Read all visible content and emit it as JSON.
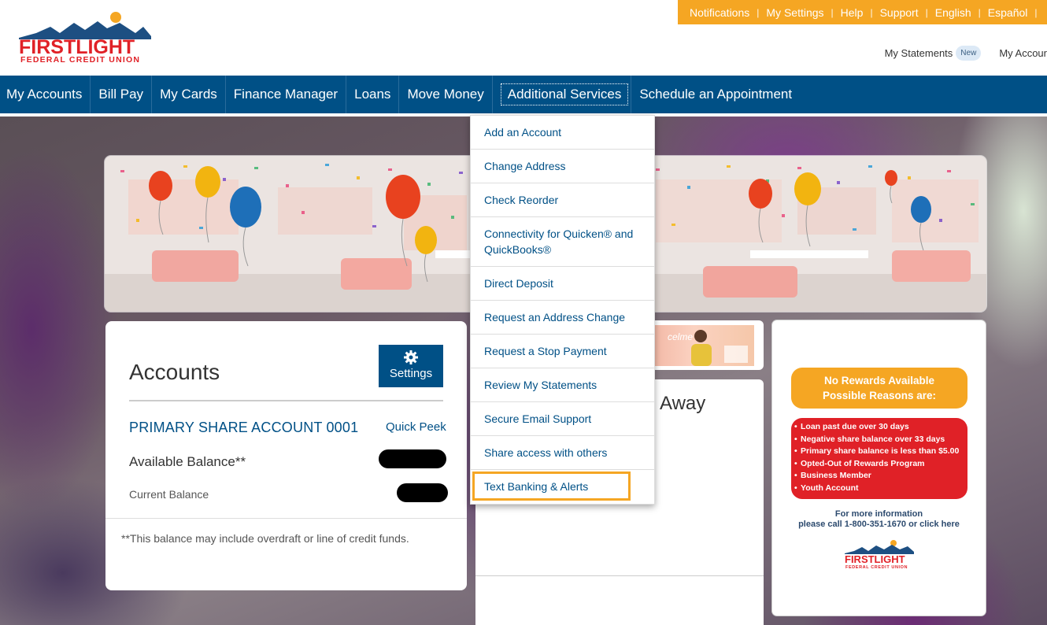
{
  "header": {
    "logo": {
      "brand": "FIRSTLIGHT",
      "subtitle": "FEDERAL CREDIT UNION"
    },
    "utility_links": [
      "Notifications",
      "My Settings",
      "Help",
      "Support",
      "English",
      "Español"
    ],
    "top_links": {
      "statements": "My Statements",
      "statements_badge": "New",
      "accounts": "My Accour"
    }
  },
  "nav": {
    "items": [
      "My Accounts",
      "Bill Pay",
      "My Cards",
      "Finance Manager",
      "Loans",
      "Move Money",
      "Additional Services",
      "Schedule an Appointment"
    ],
    "active_index": 6
  },
  "dropdown": {
    "items": [
      "Add an Account",
      "Change Address",
      "Check Reorder",
      "Connectivity for Quicken® and QuickBooks®",
      "Direct Deposit",
      "Request an Address Change",
      "Request a Stop Payment",
      "Review My Statements",
      "Secure Email Support",
      "Share access with others",
      "Text Banking & Alerts"
    ],
    "focused_index": 10
  },
  "accounts": {
    "title": "Accounts",
    "settings_label": "Settings",
    "account_name": "PRIMARY SHARE ACCOUNT 0001",
    "quick_peek": "Quick Peek",
    "available_label": "Available Balance**",
    "current_label": "Current Balance",
    "footnote": "**This balance may include overdraft or line of credit funds."
  },
  "promo": {
    "word": "celme"
  },
  "middle": {
    "heading": "Away"
  },
  "rewards": {
    "head_line1": "No Rewards Available",
    "head_line2": "Possible Reasons are:",
    "reasons": [
      "Loan past due over 30 days",
      "Negative share balance over 33 days",
      "Primary share balance is less than $5.00",
      "Opted-Out of Rewards Program",
      "Business Member",
      "Youth Account"
    ],
    "more_line1": "For more information",
    "more_line2": "please call 1-800-351-1670 or click here"
  },
  "colors": {
    "brand_blue": "#005086",
    "accent_orange": "#f5a623",
    "alert_red": "#e02127",
    "logo_red": "#e02127"
  },
  "icons": {
    "settings": "gear-icon"
  }
}
